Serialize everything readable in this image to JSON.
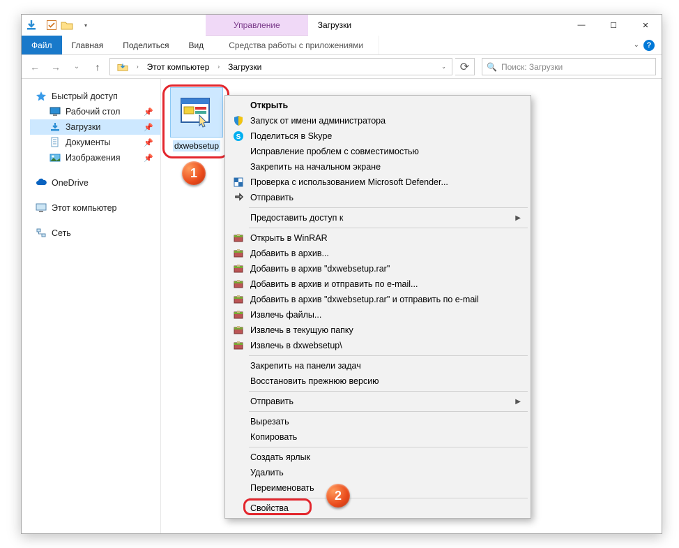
{
  "titlebar": {
    "context_tab": "Управление",
    "window_title": "Загрузки",
    "minimize": "—",
    "maximize": "☐",
    "close": "✕"
  },
  "ribbon": {
    "file": "Файл",
    "home": "Главная",
    "share": "Поделиться",
    "view": "Вид",
    "context_group": "Средства работы с приложениями",
    "help": "?",
    "caret": "⌄"
  },
  "nav": {
    "back": "←",
    "forward": "→",
    "recent_caret": "⌄",
    "up": "↑",
    "breadcrumb": {
      "pc_caret": "›",
      "this_pc": "Этот компьютер",
      "downloads": "Загрузки",
      "end_caret": "⌄"
    },
    "refresh": "⟳",
    "search_placeholder": "Поиск: Загрузки",
    "search_icon": "🔍"
  },
  "sidebar": {
    "quick_access": "Быстрый доступ",
    "desktop": "Рабочий стол",
    "downloads": "Загрузки",
    "documents": "Документы",
    "pictures": "Изображения",
    "onedrive": "OneDrive",
    "this_pc": "Этот компьютер",
    "network": "Сеть"
  },
  "file": {
    "name": "dxwebsetup"
  },
  "badges": {
    "one": "1",
    "two": "2"
  },
  "ctx": {
    "open": "Открыть",
    "run_as_admin": "Запуск от имени администратора",
    "share_skype": "Поделиться в Skype",
    "troubleshoot": "Исправление проблем с совместимостью",
    "pin_start": "Закрепить на начальном экране",
    "defender": "Проверка с использованием Microsoft Defender...",
    "share": "Отправить",
    "give_access": "Предоставить доступ к",
    "open_winrar": "Открыть в WinRAR",
    "add_archive": "Добавить в архив...",
    "add_archive_named": "Добавить в архив \"dxwebsetup.rar\"",
    "add_archive_email": "Добавить в архив и отправить по e-mail...",
    "add_archive_named_email": "Добавить в архив \"dxwebsetup.rar\" и отправить по e-mail",
    "extract": "Извлечь файлы...",
    "extract_here": "Извлечь в текущую папку",
    "extract_to": "Извлечь в dxwebsetup\\",
    "pin_taskbar": "Закрепить на панели задач",
    "restore_prev": "Восстановить прежнюю версию",
    "send_to": "Отправить",
    "cut": "Вырезать",
    "copy": "Копировать",
    "create_shortcut": "Создать ярлык",
    "delete": "Удалить",
    "rename": "Переименовать",
    "properties": "Свойства"
  }
}
